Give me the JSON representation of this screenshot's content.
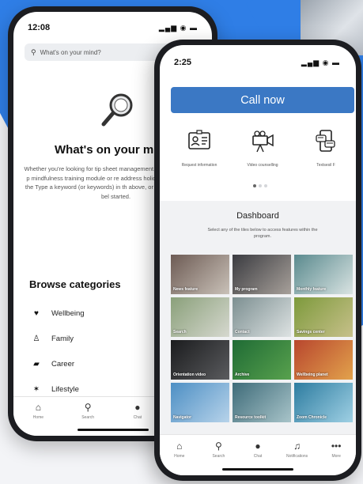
{
  "back_phone": {
    "status_time": "12:08",
    "status_icons": "▂▄▆ ◉ ▬",
    "search_placeholder": "What's on your mind?",
    "title": "What's on your mi",
    "description": "Whether you're looking for tip sheet management, a search engine for p mindfulness training module or re address holiday stress, you're in the Type a keyword (or keywords) in th above, or browse by category bel started.",
    "browse_title": "Browse categories",
    "categories": [
      {
        "label": "Wellbeing",
        "icon": "heart-icon",
        "glyph": "♥"
      },
      {
        "label": "Family",
        "icon": "family-icon",
        "glyph": "♙"
      },
      {
        "label": "Career",
        "icon": "briefcase-icon",
        "glyph": "▰"
      },
      {
        "label": "Lifestyle",
        "icon": "lifestyle-icon",
        "glyph": "✶"
      }
    ],
    "nav": [
      {
        "label": "Home",
        "glyph": "⌂",
        "icon": "home-icon"
      },
      {
        "label": "Search",
        "glyph": "⚲",
        "icon": "search-icon"
      },
      {
        "label": "Chat",
        "glyph": "●",
        "icon": "chat-icon"
      },
      {
        "label": "",
        "glyph": "",
        "icon": "blank-icon"
      }
    ]
  },
  "front_phone": {
    "status_time": "2:25",
    "status_icons": "▂▄▆ ◉ ▬",
    "call_label": "Call now",
    "features": [
      {
        "label": "Request information",
        "icon": "id-card-icon"
      },
      {
        "label": "Video counselling",
        "icon": "video-camera-icon"
      },
      {
        "label": "Textsesil F",
        "icon": "phone-chat-icon"
      }
    ],
    "dashboard_title": "Dashboard",
    "dashboard_subtitle": "Select any of the tiles below to access features within the program.",
    "tiles": [
      {
        "label": "News feature",
        "color1": "#6d5b54",
        "color2": "#c9c1b8"
      },
      {
        "label": "My program",
        "color1": "#3a3b40",
        "color2": "#a7a09a"
      },
      {
        "label": "Monthly feature",
        "color1": "#5a8a8e",
        "color2": "#d9e3e2"
      },
      {
        "label": "Search",
        "color1": "#8aa07a",
        "color2": "#d6d8cf"
      },
      {
        "label": "Contact",
        "color1": "#7c8f91",
        "color2": "#dde2e2"
      },
      {
        "label": "Savings center",
        "color1": "#7d9a3c",
        "color2": "#c7c08a"
      },
      {
        "label": "Orientation video",
        "color1": "#1b1c1e",
        "color2": "#5a5b5e"
      },
      {
        "label": "Archive",
        "color1": "#1f6b35",
        "color2": "#58a14d"
      },
      {
        "label": "Wellbeing planet",
        "color1": "#b8462e",
        "color2": "#e2a24c"
      },
      {
        "label": "Navigator",
        "color1": "#4d8fc4",
        "color2": "#b7d3ea"
      },
      {
        "label": "Resource toolkit",
        "color1": "#3e6b79",
        "color2": "#a8c4c9"
      },
      {
        "label": "Zoom Chronicle",
        "color1": "#2d7ca0",
        "color2": "#9fd0e4"
      }
    ],
    "nav": [
      {
        "label": "Home",
        "glyph": "⌂",
        "icon": "home-icon"
      },
      {
        "label": "Search",
        "glyph": "⚲",
        "icon": "search-icon"
      },
      {
        "label": "Chat",
        "glyph": "●",
        "icon": "chat-icon"
      },
      {
        "label": "Notifications",
        "glyph": "♫",
        "icon": "bell-icon"
      },
      {
        "label": "More",
        "glyph": "•••",
        "icon": "more-icon"
      }
    ]
  },
  "colors": {
    "brand_blue": "#2f7ee6",
    "button_blue": "#3b78c4"
  }
}
